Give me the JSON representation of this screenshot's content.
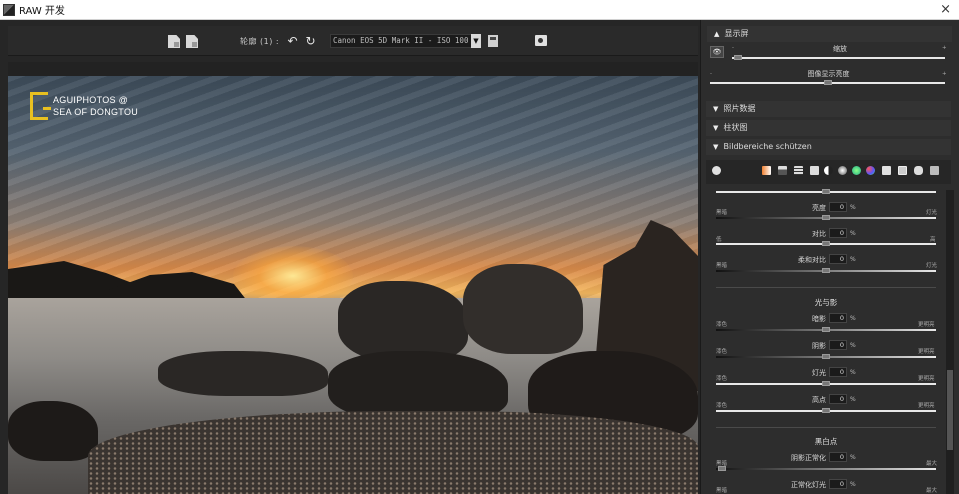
{
  "window": {
    "title": "RAW 开发",
    "close_glyph": "×",
    "icon": "app-icon"
  },
  "toolbar": {
    "label": "轮廓 (1) :",
    "preset_value": "Canon EOS 5D Mark II - ISO 100",
    "dropdown_glyph": "▼",
    "undo_glyph": "↶",
    "redo_glyph": "↻"
  },
  "photo": {
    "watermark_line1": "AGUIPHOTOS @",
    "watermark_line2": "SEA OF DONGTOU"
  },
  "panel": {
    "display": {
      "header": "显示屏",
      "zoom_label": "缩放",
      "brightness_label": "图像显示亮度",
      "minus": "-",
      "plus": "+"
    },
    "photo_data": {
      "header": "照片数据"
    },
    "histogram": {
      "header": "柱状图"
    },
    "protect": {
      "header": "Bildbereiche schützen"
    },
    "tone": {
      "sliders": [
        {
          "label": "亮度",
          "value": "0",
          "left": "黑暗",
          "right": "灯光"
        },
        {
          "label": "对比",
          "value": "0",
          "left": "低",
          "right": "高"
        },
        {
          "label": "柔和对比",
          "value": "0",
          "left": "黑暗",
          "right": "灯光"
        }
      ]
    },
    "light_shadow": {
      "title": "光与影",
      "sliders": [
        {
          "label": "暗影",
          "value": "0",
          "left": "漆色",
          "right": "更明亮"
        },
        {
          "label": "阴影",
          "value": "0",
          "left": "漆色",
          "right": "更明亮"
        },
        {
          "label": "灯光",
          "value": "0",
          "left": "漆色",
          "right": "更明亮"
        },
        {
          "label": "高点",
          "value": "0",
          "left": "漆色",
          "right": "更明亮"
        }
      ]
    },
    "black_white": {
      "title": "黑白点",
      "sliders": [
        {
          "label": "阴影正常化",
          "value": "0",
          "left": "黑暗",
          "right": "最大"
        },
        {
          "label": "正常化灯光",
          "value": "0",
          "left": "黑暗",
          "right": "最大"
        }
      ]
    },
    "pct_symbol": "%",
    "arrow_up": "▲",
    "arrow_down": "▼",
    "eye_glyph": "👁"
  },
  "colors": {
    "accent_logo": "#e8c020",
    "panel_bg": "#2d2d2d"
  }
}
